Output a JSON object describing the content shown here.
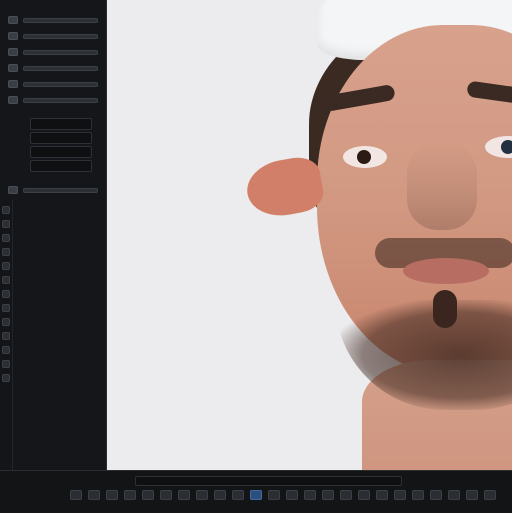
{
  "app": {
    "title": ""
  },
  "left_panel": {
    "field_texts": [
      "",
      "",
      "",
      ""
    ],
    "row_count": 13,
    "tool_icon_count": 26
  },
  "bottom_toolbar": {
    "label": "",
    "timeline_label": "",
    "tool_icon_count": 28
  },
  "colors": {
    "ui_background": "#111214",
    "viewport_background": "#ecebed",
    "accent_blue": "#3f6aa2",
    "skin_tone": "#d39a83",
    "hair_beard": "#3a2a22",
    "cap": "#f4f5f6"
  }
}
